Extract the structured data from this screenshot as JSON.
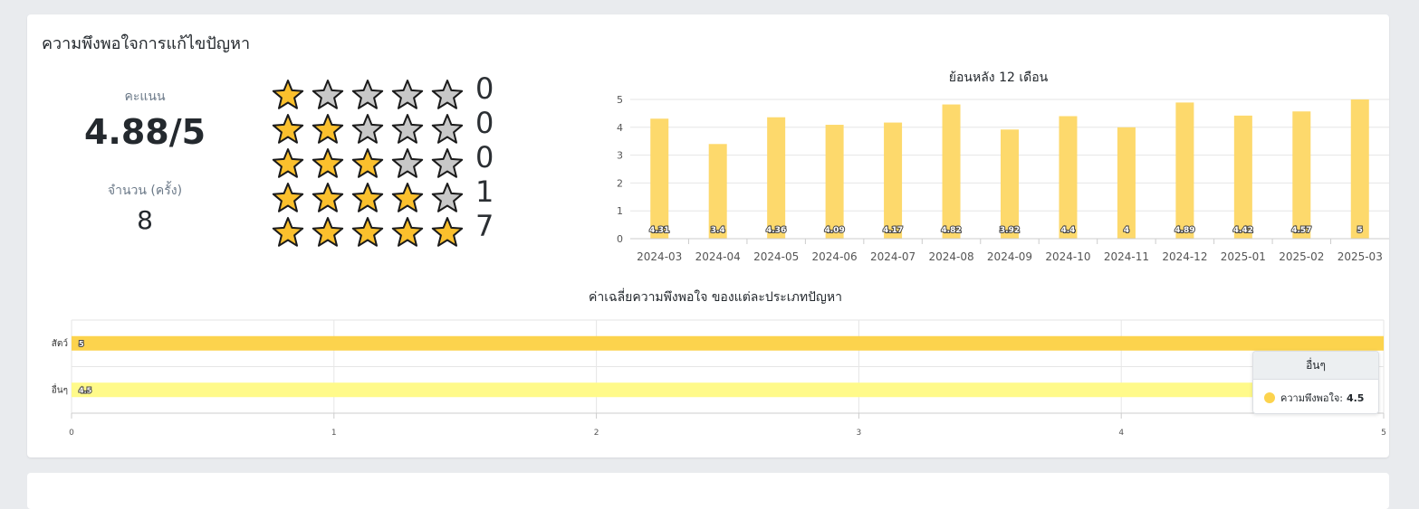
{
  "card": {
    "title": "ความพึงพอใจการแก้ไขปัญหา"
  },
  "summary": {
    "score_label": "คะแนน",
    "score_value": "4.88/5",
    "count_label": "จำนวน (ครั้ง)",
    "count_value": "8"
  },
  "rating_breakdown": [
    {
      "stars": 1,
      "count": "0"
    },
    {
      "stars": 2,
      "count": "0"
    },
    {
      "stars": 3,
      "count": "0"
    },
    {
      "stars": 4,
      "count": "1"
    },
    {
      "stars": 5,
      "count": "7"
    }
  ],
  "colors": {
    "star_filled": "#fbc02d",
    "star_empty": "#c8c8c8",
    "bar_monthly": "#fdd96c",
    "bar_animal": "#fcd34d",
    "bar_other": "#fffa8a"
  },
  "chart_data": [
    {
      "type": "bar",
      "title": "ย้อนหลัง 12 เดือน",
      "categories": [
        "2024-03",
        "2024-04",
        "2024-05",
        "2024-06",
        "2024-07",
        "2024-08",
        "2024-09",
        "2024-10",
        "2024-11",
        "2024-12",
        "2025-01",
        "2025-02",
        "2025-03"
      ],
      "values": [
        4.31,
        3.4,
        4.36,
        4.09,
        4.17,
        4.82,
        3.92,
        4.4,
        4,
        4.89,
        4.42,
        4.57,
        5
      ],
      "yticks": [
        "0",
        "1",
        "2",
        "3",
        "4",
        "5"
      ],
      "ylim": [
        0,
        5
      ],
      "grid": true
    },
    {
      "type": "bar",
      "orientation": "horizontal",
      "title": "ค่าเฉลี่ยความพึงพอใจ ของแต่ละประเภทปัญหา",
      "categories": [
        "สัตว์",
        "อื่นๆ"
      ],
      "values": [
        5,
        4.5
      ],
      "xticks": [
        "0",
        "1",
        "2",
        "3",
        "4",
        "5"
      ],
      "xlim": [
        0,
        5
      ],
      "grid": true
    }
  ],
  "tooltip": {
    "title": "อื่นๆ",
    "label": "ความพึงพอใจ:",
    "value": "4.5"
  }
}
